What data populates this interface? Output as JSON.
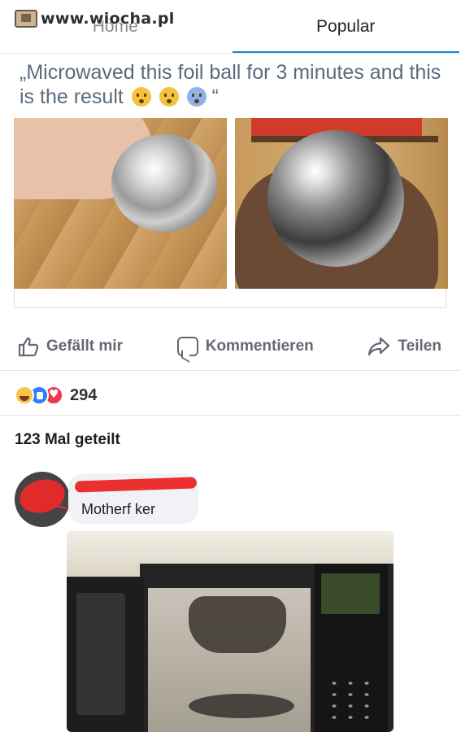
{
  "watermark": {
    "text": "www.wiocha.pl"
  },
  "tabs": [
    {
      "label": "Home",
      "active": false
    },
    {
      "label": "Popular",
      "active": true
    }
  ],
  "post": {
    "quote_prefix": "„Microwaved this foil ball for 3 minutes and this is the result",
    "quote_suffix": "“",
    "emojis": [
      "anguished-face-emoji",
      "hushed-face-emoji",
      "face-screaming-emoji"
    ]
  },
  "actions": {
    "like_label": "Gefällt mir",
    "comment_label": "Kommentieren",
    "share_label": "Teilen"
  },
  "reactions": {
    "types": [
      "haha",
      "like",
      "love"
    ],
    "count": "294"
  },
  "shares": {
    "label": "123 Mal geteilt"
  },
  "comment": {
    "text": "Motherf  ker"
  },
  "colors": {
    "active_tab_underline": "#1a88d6",
    "like_reaction": "#2e80f6",
    "love_reaction": "#f0384c",
    "haha_reaction": "#f7c548"
  }
}
